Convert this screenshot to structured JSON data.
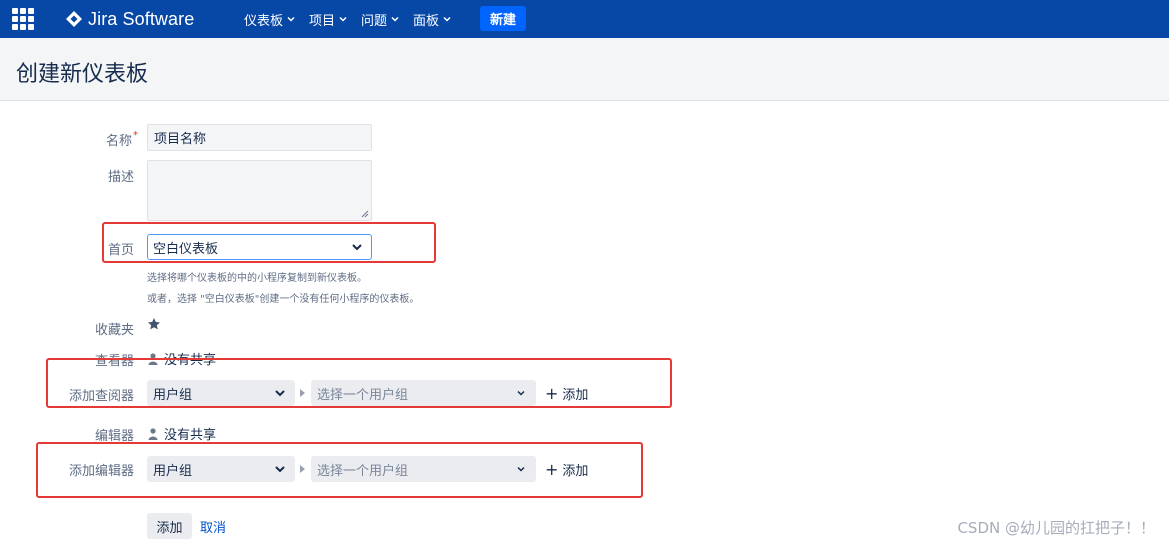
{
  "nav": {
    "app_name": "Jira Software",
    "items": [
      {
        "label": "仪表板"
      },
      {
        "label": "项目"
      },
      {
        "label": "问题"
      },
      {
        "label": "面板"
      }
    ],
    "create_label": "新建"
  },
  "page": {
    "title": "创建新仪表板"
  },
  "form": {
    "name": {
      "label": "名称",
      "required_mark": "*",
      "value": "项目名称"
    },
    "description": {
      "label": "描述",
      "value": ""
    },
    "start_from": {
      "label": "首页",
      "value": "空白仪表板",
      "help_1": "选择将哪个仪表板的中的小程序复制到新仪表板。",
      "help_2": "或者，选择 \"空白仪表板\"创建一个没有任何小程序的仪表板。"
    },
    "favourite": {
      "label": "收藏夹"
    },
    "viewers": {
      "label": "查看器",
      "value": "没有共享"
    },
    "add_viewers": {
      "label": "添加查阅器",
      "type_value": "用户组",
      "group_placeholder": "选择一个用户组",
      "add_label": "添加"
    },
    "editors": {
      "label": "编辑器",
      "value": "没有共享"
    },
    "add_editors": {
      "label": "添加编辑器",
      "type_value": "用户组",
      "group_placeholder": "选择一个用户组",
      "add_label": "添加"
    },
    "submit_label": "添加",
    "cancel_label": "取消"
  },
  "watermark": "CSDN @幼儿园的扛把子！！",
  "colors": {
    "nav_bg": "#0747a6",
    "create_btn": "#0065ff",
    "highlight": "#e53935",
    "link": "#0052cc"
  }
}
